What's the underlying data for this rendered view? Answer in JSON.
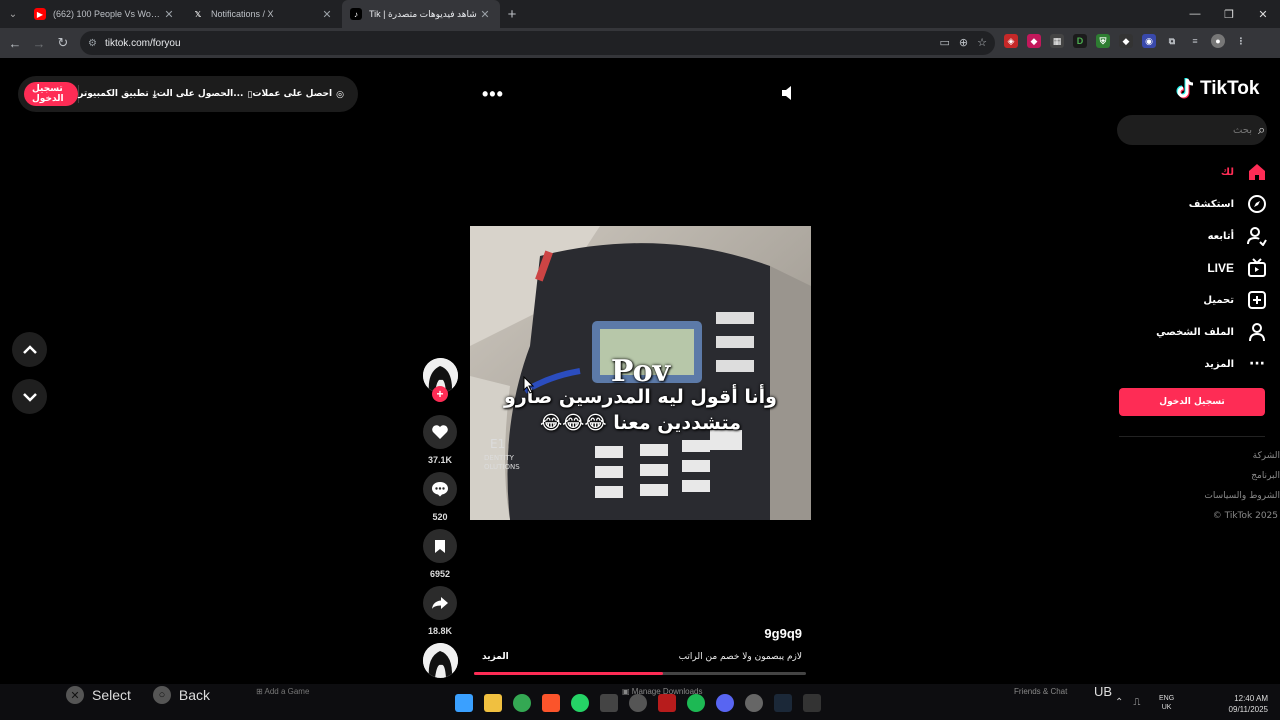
{
  "browser": {
    "tabs": [
      {
        "title": "(662) 100 People Vs World's Big",
        "favicon": "youtube-icon",
        "color": "#ff0000"
      },
      {
        "title": "Notifications / X",
        "favicon": "x-icon",
        "color": "#ffffff"
      },
      {
        "title": "شاهد فيديوهات متصدرة | Tik",
        "favicon": "tiktok-icon",
        "color": "#000000",
        "active": true
      }
    ],
    "url": "tiktok.com/foryou"
  },
  "tiktok": {
    "logo_text": "TikTok",
    "top_pill": {
      "login_label": "تسجيل الدخول",
      "desktop_app_label": "تطبيق الكمبيوتر",
      "get_app_label": "الحصول على الت...",
      "coins_label": "احصل على عملات"
    },
    "search_placeholder": "بحث",
    "menu": [
      {
        "label": "لك",
        "icon": "home-icon",
        "active": true
      },
      {
        "label": "استكشف",
        "icon": "compass-icon"
      },
      {
        "label": "أتابعه",
        "icon": "following-icon"
      },
      {
        "label": "LIVE",
        "icon": "live-icon"
      },
      {
        "label": "تحميل",
        "icon": "upload-icon"
      },
      {
        "label": "الملف الشخصي",
        "icon": "profile-icon"
      },
      {
        "label": "المزيد",
        "icon": "more-dots-icon"
      }
    ],
    "sidebar_login_label": "تسجيل الدخول",
    "footer_links": [
      "الشركة",
      "البرنامج",
      "الشروط والسياسات",
      "© TikTok 2025"
    ],
    "video": {
      "caption_line1": "Pov",
      "caption_line2": "وأنا أقول ليه المدرسين صارو",
      "caption_line3": "متشددين معنا 😂😂😂",
      "author": "9g9q9",
      "description": "لازم يبصمون ولا خصم من الراتب",
      "more_label": "المزيد",
      "progress": 0.57
    },
    "actions": {
      "likes": "37.1K",
      "comments": "520",
      "saves": "6952",
      "shares": "18.8K"
    },
    "accent_color": "#fe2c55"
  },
  "taskbar": {
    "select_label": "Select",
    "back_label": "Back",
    "add_game_label": "Add a Game",
    "manage_downloads_label": "Manage Downloads",
    "friends_label": "Friends & Chat",
    "ub_label": "UB",
    "lang_line1": "ENG",
    "lang_line2": "UK",
    "time": "12:40 AM",
    "date": "09/11/2025"
  }
}
